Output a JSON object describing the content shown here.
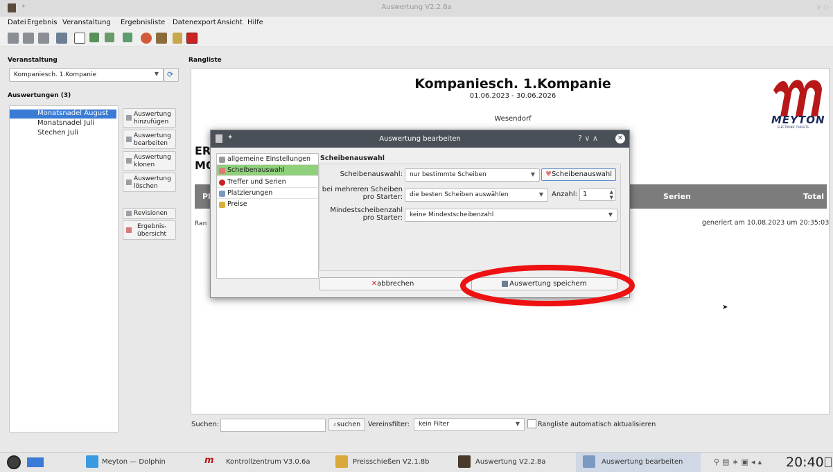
{
  "window": {
    "title": "Auswertung V2.2.8a"
  },
  "menu": [
    "Datei",
    "Ergebnis",
    "Veranstaltung",
    "Ergebnisliste",
    "Datenexport",
    "Ansicht",
    "Hilfe"
  ],
  "left": {
    "veranstaltung_title": "Veranstaltung",
    "veranstaltung_value": "Kompaniesch. 1.Kompanie",
    "auswertungen_title": "Auswertungen (3)",
    "list": [
      "Monatsnadel August",
      "Monatsnadel Juli",
      "Stechen Juli"
    ],
    "buttons": {
      "add": "Auswertung hinzufügen",
      "edit": "Auswertung bearbeiten",
      "clone": "Auswertung klonen",
      "delete": "Auswertung löschen",
      "revisions": "Revisionen",
      "overview": "Ergebnis-übersicht"
    }
  },
  "right": {
    "rangliste_title": "Rangliste",
    "heading": "Kompaniesch. 1.Kompanie",
    "dates": "01.06.2023 - 30.06.2026",
    "location": "Wesendorf",
    "logo_text": "MEYTON",
    "logo_sub": "ELECTRONIC TARGETS",
    "partial_er": "ER",
    "partial_mo": "MO",
    "col_pl": "Pl",
    "col_serien": "Serien",
    "col_total": "Total",
    "ran": "Ran",
    "generated": "generiert am 10.08.2023 um 20:35:03",
    "search_label": "Suchen:",
    "search_button": "suchen",
    "filter_label": "Vereinsfilter:",
    "filter_value": "kein Filter",
    "auto_update": "Rangliste automatisch aktualisieren"
  },
  "dialog": {
    "title": "Auswertung bearbeiten",
    "nav": [
      "allgemeine Einstellungen",
      "Scheibenauswahl",
      "Treffer und Serien",
      "Platzierungen",
      "Preise"
    ],
    "section_title": "Scheibenauswahl",
    "label_scheibenauswahl": "Scheibenauswahl:",
    "value_scheibenauswahl": "nur bestimmte Scheiben",
    "button_scheibenauswahl": "Scheibenauswahl",
    "label_mehrere": "bei mehreren Scheiben pro Starter:",
    "value_mehrere": "die besten Scheiben auswählen",
    "label_anzahl": "Anzahl:",
    "value_anzahl": "1",
    "label_mindest": "Mindestscheibenzahl pro Starter:",
    "value_mindest": "keine Mindestscheibenzahl",
    "cancel": "abbrechen",
    "save": "Auswertung speichern",
    "title_controls": "?  ∨  ∧"
  },
  "taskbar": {
    "tasks": [
      "Meyton — Dolphin",
      "Kontrollzentrum V3.0.6a",
      "Preisschießen V2.1.8b",
      "Auswertung V2.2.8a",
      "Auswertung bearbeiten"
    ],
    "clock": "20:40"
  },
  "colors": {
    "selection": "#3a7bd5",
    "active_nav": "#8fd17b",
    "header_gray": "#7c7c7c",
    "highlight_circle": "#ee1111",
    "meyton_red": "#b81818"
  }
}
